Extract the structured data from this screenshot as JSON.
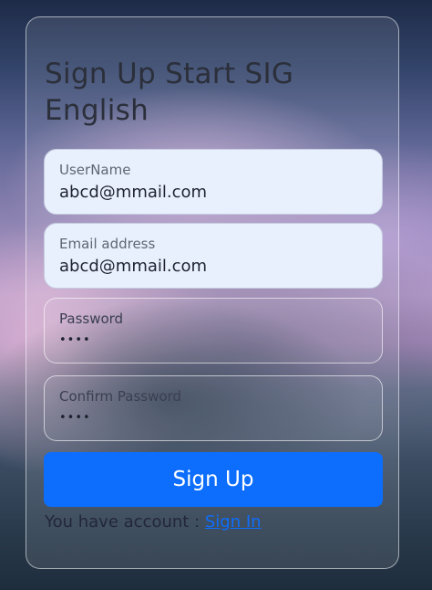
{
  "form": {
    "title": "Sign Up Start SIG English",
    "username": {
      "label": "UserName",
      "value": "abcd@mmail.com"
    },
    "email": {
      "label": "Email address",
      "value": "abcd@mmail.com"
    },
    "password": {
      "label": "Password",
      "value": "••••"
    },
    "confirm_password": {
      "label": "Confirm Password",
      "value": "••••"
    },
    "submit_label": "Sign Up",
    "footer": {
      "prompt": "You have account : ",
      "link_label": "Sign In"
    }
  },
  "colors": {
    "accent": "#0d6efd",
    "input_filled_bg": "#e8f0fe",
    "title_text": "#2b2f3a"
  }
}
